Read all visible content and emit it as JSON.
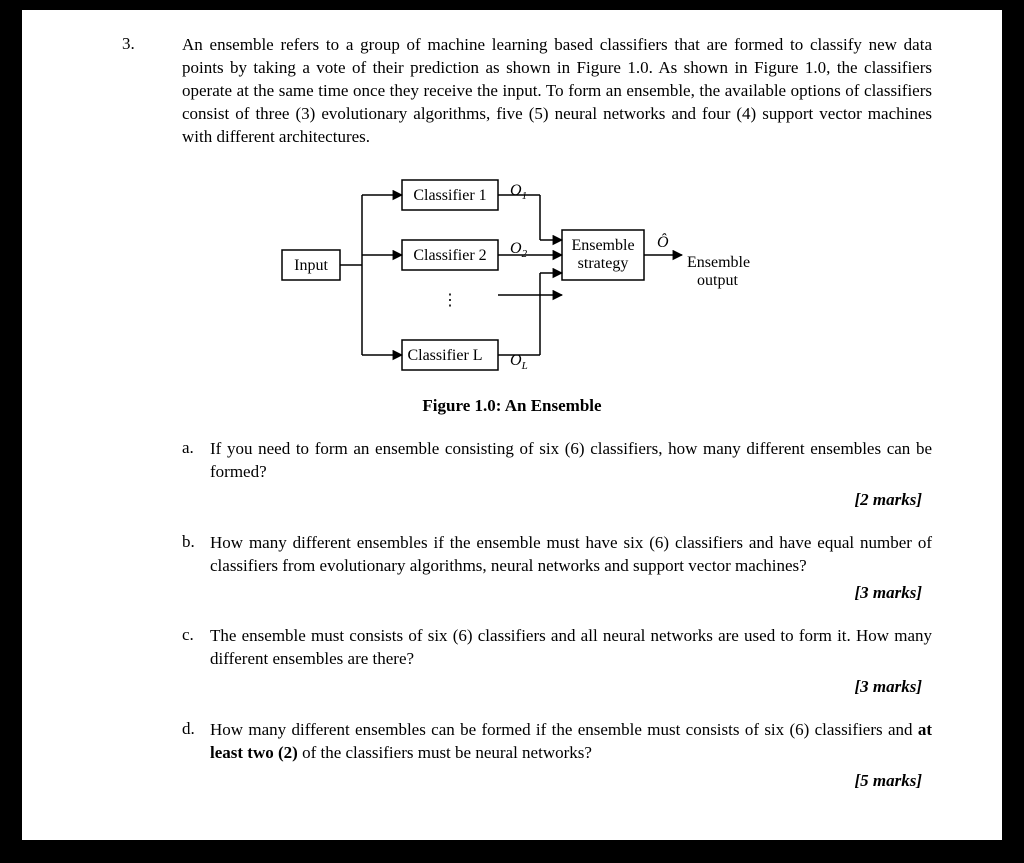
{
  "question_number": "3.",
  "intro": "An ensemble refers to a group of machine learning based classifiers that are formed to classify new data points by taking a vote of their prediction as shown in Figure 1.0. As shown in Figure 1.0, the classifiers operate at the same time once they receive the input. To form an ensemble, the available options of classifiers consist of three (3) evolutionary algorithms, five (5) neural networks and four (4) support vector machines with different architectures.",
  "diagram": {
    "input": "Input",
    "classifier1": "Classifier 1",
    "classifier2": "Classifier 2",
    "classifierL": "Classifier L",
    "o1": "O",
    "o1_sub": "1",
    "o2": "O",
    "o2_sub": "2",
    "oL": "O",
    "oL_sub": "L",
    "ensemble_line1": "Ensemble",
    "ensemble_line2": "strategy",
    "ohat": "Ô",
    "out_line1": "Ensemble",
    "out_line2": "output",
    "vdots": "⋮"
  },
  "caption": "Figure 1.0: An Ensemble",
  "parts": {
    "a": {
      "label": "a.",
      "text": "If you need to form an ensemble consisting of six (6) classifiers, how many different ensembles can be formed?",
      "marks": "[2 marks]"
    },
    "b": {
      "label": "b.",
      "text": "How many different ensembles if the ensemble must have six (6) classifiers and have equal number of classifiers from evolutionary algorithms, neural networks and support vector machines?",
      "marks": "[3 marks]"
    },
    "c": {
      "label": "c.",
      "text": "The ensemble must consists of six (6) classifiers and all neural networks are used to form it. How many different ensembles are there?",
      "marks": "[3 marks]"
    },
    "d": {
      "label": "d.",
      "text_pre": "How many different ensembles can be formed if the ensemble must consists of six (6) classifiers and ",
      "text_bold": "at least two (2)",
      "text_post": " of the classifiers must be neural networks?",
      "marks": "[5 marks]"
    }
  }
}
